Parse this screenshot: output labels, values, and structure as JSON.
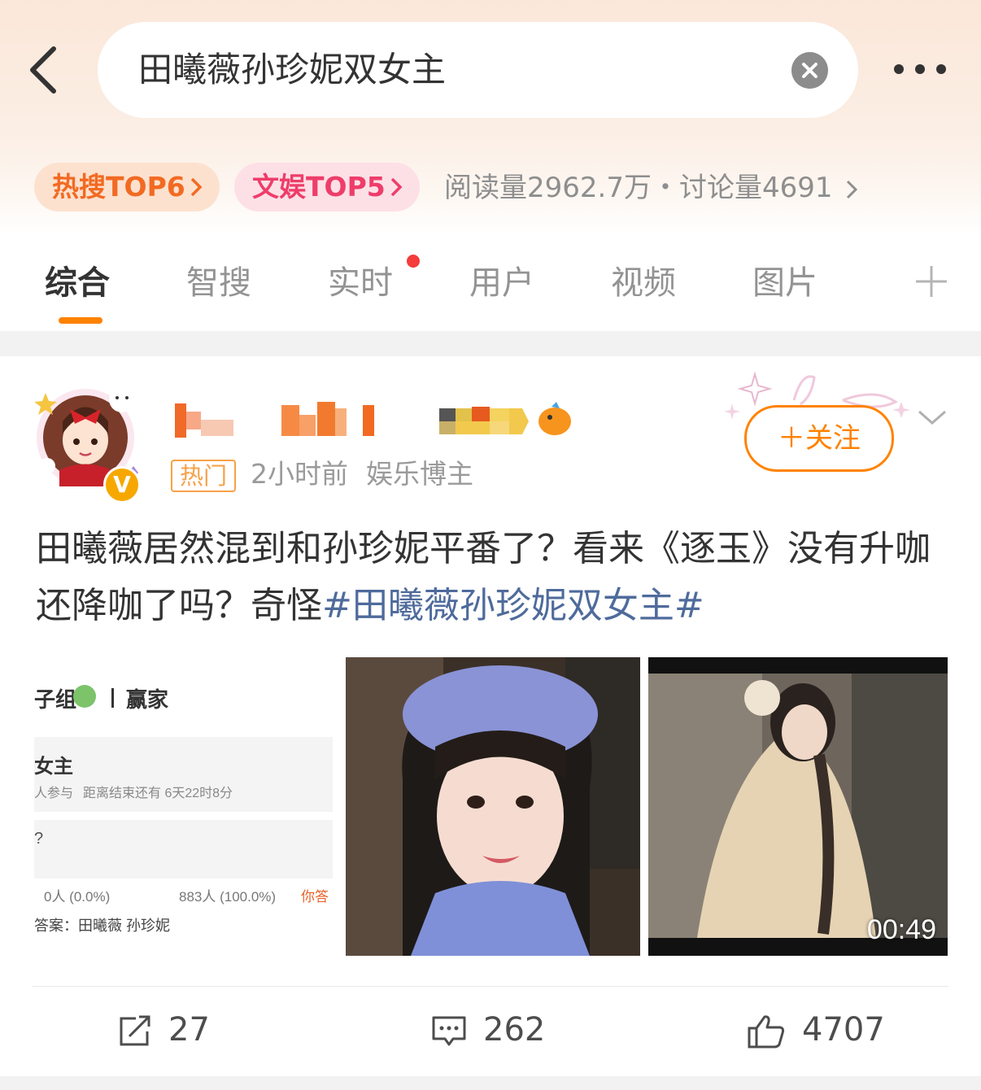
{
  "search": {
    "query": "田曦薇孙珍妮双女主"
  },
  "pills": {
    "hot_search": "热搜TOP6",
    "entertainment": "文娱TOP5"
  },
  "stats": {
    "text": "阅读量2962.7万・讨论量4691"
  },
  "tabs": [
    "综合",
    "智搜",
    "实时",
    "用户",
    "视频",
    "图片"
  ],
  "post": {
    "hot_badge": "热门",
    "time": "2小时前",
    "identity": "娱乐博主",
    "follow_label": "＋关注",
    "text": "田曦薇居然混到和孙珍妮平番了？看来《逐玉》没有升咖还降咖了吗？奇怪",
    "hashtag": "#田曦薇孙珍妮双女主#",
    "screenshot": {
      "header": "子组",
      "header_right": "赢家",
      "title": "女主",
      "participants": "人参与",
      "countdown": "距离结束还有 6天22时8分",
      "question_mark": "?",
      "option_left": "0人 (0.0%)",
      "option_right": "883人 (100.0%)",
      "you_answered": "你答",
      "answer": "答案：田曦薇 孙珍妮"
    },
    "video_duration": "00:49"
  },
  "actions": {
    "repost": "27",
    "comment": "262",
    "like": "4707"
  },
  "colors": {
    "accent": "#ff8200",
    "hashtag": "#4f6b9c",
    "hot": "#f26a22",
    "ent": "#ee3d6a"
  }
}
